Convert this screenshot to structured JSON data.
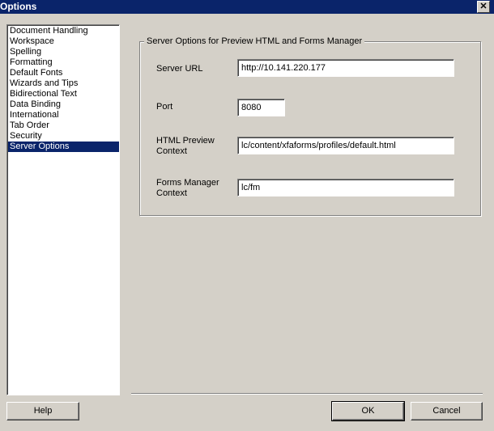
{
  "window": {
    "title": "Options",
    "close_glyph": "✕"
  },
  "categories": [
    {
      "label": "Document Handling",
      "selected": false
    },
    {
      "label": "Workspace",
      "selected": false
    },
    {
      "label": "Spelling",
      "selected": false
    },
    {
      "label": "Formatting",
      "selected": false
    },
    {
      "label": "Default Fonts",
      "selected": false
    },
    {
      "label": "Wizards and Tips",
      "selected": false
    },
    {
      "label": "Bidirectional Text",
      "selected": false
    },
    {
      "label": "Data Binding",
      "selected": false
    },
    {
      "label": "International",
      "selected": false
    },
    {
      "label": "Tab Order",
      "selected": false
    },
    {
      "label": "Security",
      "selected": false
    },
    {
      "label": "Server Options",
      "selected": true
    }
  ],
  "server_options": {
    "group_title": "Server Options for Preview HTML and Forms Manager",
    "server_url_label": "Server URL",
    "server_url_value": "http://10.141.220.177",
    "port_label": "Port",
    "port_value": "8080",
    "html_preview_label_line1": "HTML Preview",
    "html_preview_label_line2": "Context",
    "html_preview_value": "lc/content/xfaforms/profiles/default.html",
    "forms_manager_label_line1": "Forms Manager",
    "forms_manager_label_line2": "Context",
    "forms_manager_value": "lc/fm"
  },
  "buttons": {
    "help": "Help",
    "ok": "OK",
    "cancel": "Cancel"
  }
}
